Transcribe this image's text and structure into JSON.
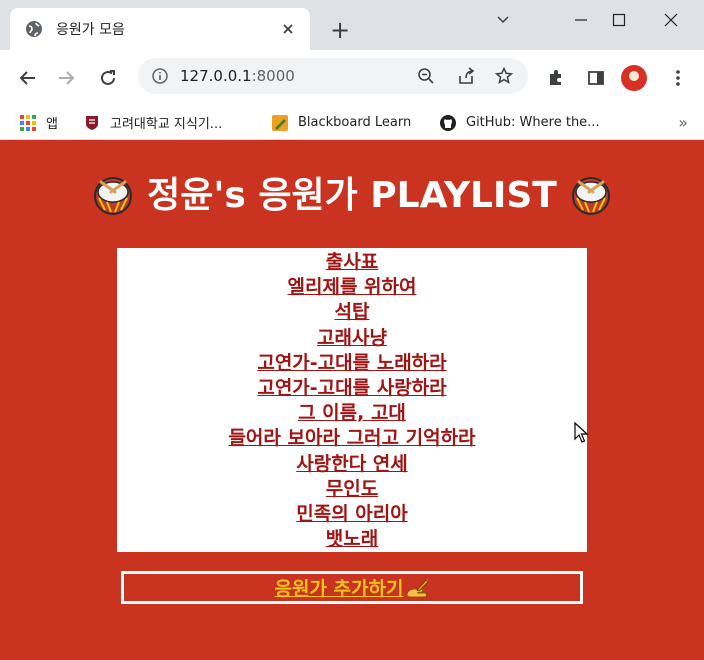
{
  "browser": {
    "tab_title": "응원가 모음",
    "url_host": "127.0.0.1",
    "url_port": ":8000",
    "bookmarks": [
      {
        "label": "앱"
      },
      {
        "label": "고려대학교 지식기..."
      },
      {
        "label": "Blackboard Learn"
      },
      {
        "label": "GitHub: Where the..."
      }
    ],
    "bookmarks_more": "»",
    "new_tab": "+"
  },
  "page": {
    "title": "정윤's 응원가 PLAYLIST",
    "songs": [
      "출사표",
      "엘리제를 위하여",
      "석탑",
      "고래사냥",
      "고연가-고대를 노래하라",
      "고연가-고대를 사랑하라",
      "그 이름, 고대",
      "들어라 보아라 그러고 기억하라",
      "사랑한다 연세",
      "무인도",
      "민족의 아리아",
      "뱃노래"
    ],
    "add_link": "응원가 추가하기"
  },
  "colors": {
    "page_bg": "#c9331f",
    "song_link": "#a11414",
    "add_link": "#f5c31a"
  },
  "icons": {
    "title_emoji": "drum-icon",
    "add_emoji": "pencil-hand-icon"
  }
}
